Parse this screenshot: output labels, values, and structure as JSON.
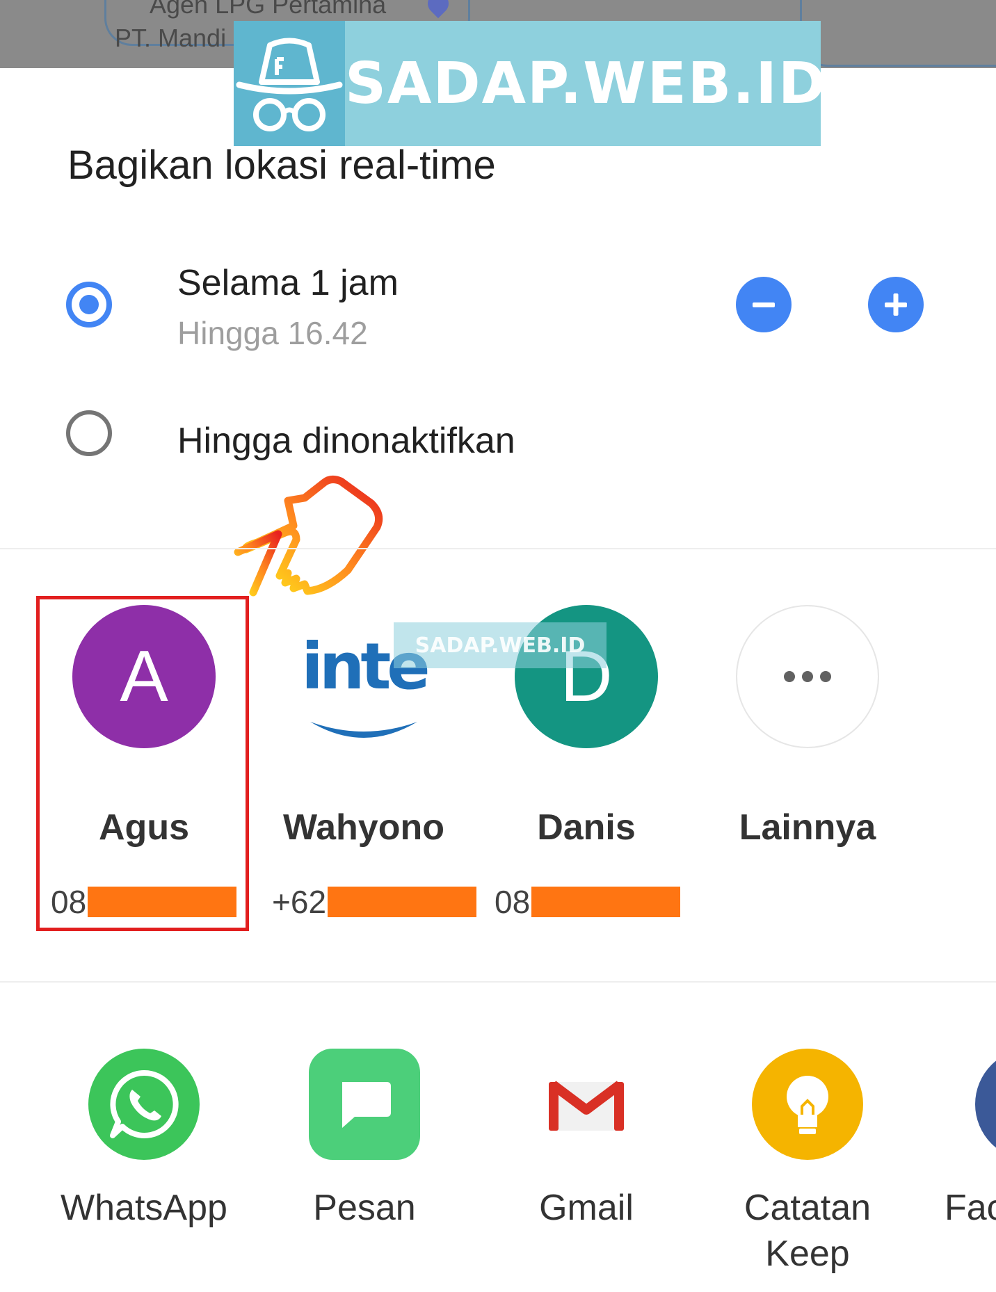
{
  "map": {
    "label_1": "Agen LPG Pertamina",
    "label_2": "PT. Mandi"
  },
  "watermark": {
    "text": "SADAP.WEB.ID",
    "small_text": "SADAP.WEB.ID"
  },
  "sheet": {
    "title": "Bagikan lokasi real-time",
    "options": [
      {
        "label": "Selama 1 jam",
        "sublabel": "Hingga 16.42",
        "selected": true
      },
      {
        "label": "Hingga dinonaktifkan",
        "selected": false
      }
    ],
    "decrease_icon": "minus-icon",
    "increase_icon": "plus-icon",
    "accent_color": "#4285f4"
  },
  "contacts": [
    {
      "name": "Agus",
      "initial": "A",
      "phone_prefix": "08",
      "avatar_color": "#8e2fa8",
      "highlighted": true
    },
    {
      "name": "Wahyono",
      "initial": "",
      "phone_prefix": "+62",
      "avatar_color": "#ffffff",
      "highlighted": false
    },
    {
      "name": "Danis",
      "initial": "D",
      "phone_prefix": "08",
      "avatar_color": "#149582",
      "highlighted": false
    },
    {
      "name": "Lainnya",
      "initial": "",
      "phone_prefix": "",
      "avatar_color": "#ffffff",
      "highlighted": false
    }
  ],
  "contact_logo_text": "inte",
  "more_icon": "more-horizontal-icon",
  "apps": [
    {
      "label": "WhatsApp",
      "icon": "whatsapp-icon",
      "color": "#3cc55a"
    },
    {
      "label": "Pesan",
      "icon": "message-icon",
      "color": "#4ccf7a"
    },
    {
      "label": "Gmail",
      "icon": "gmail-icon",
      "color": "#ffffff"
    },
    {
      "label": "Catatan Keep",
      "icon": "keep-bulb-icon",
      "color": "#f5b400"
    },
    {
      "label": "Fac",
      "icon": "facebook-icon",
      "color": "#3b5998"
    }
  ],
  "redaction_color": "#ff7512",
  "highlight_color": "#e21f1f"
}
